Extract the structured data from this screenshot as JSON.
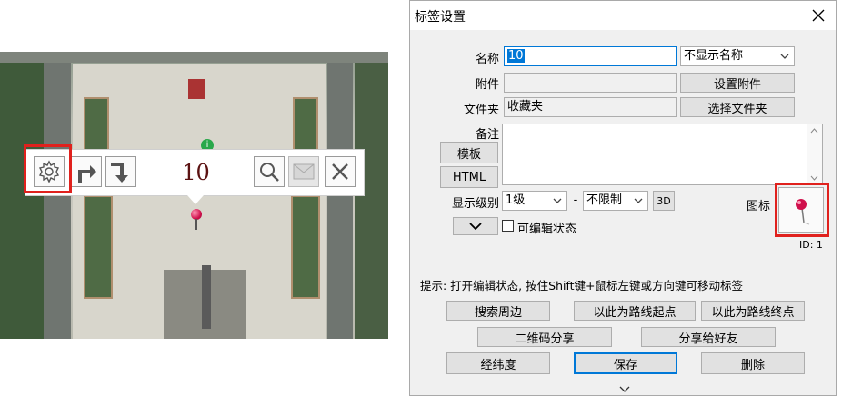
{
  "map_popup": {
    "number": "10"
  },
  "dialog": {
    "title": "标签设置",
    "labels": {
      "name": "名称",
      "attachment": "附件",
      "folder": "文件夹",
      "remark": "备注",
      "display_level": "显示级别",
      "dash": "-",
      "icon": "图标"
    },
    "name_value": "10",
    "attachment_value": "",
    "folder_value": "收藏夹",
    "remark_value": "",
    "name_display_select": "不显示名称",
    "level_min_select": "1级",
    "level_max_select": "不限制",
    "buttons": {
      "set_attachment": "设置附件",
      "choose_folder": "选择文件夹",
      "template": "模板",
      "html": "HTML",
      "three_d": "3D",
      "search_nearby": "搜索周边",
      "route_start": "以此为路线起点",
      "route_end": "以此为路线终点",
      "qr_share": "二维码分享",
      "share_friend": "分享给好友",
      "coordinates": "经纬度",
      "save": "保存",
      "delete": "删除"
    },
    "editable_label": "可编辑状态",
    "editable_checked": false,
    "id_label": "ID: 1",
    "hint": "提示: 打开编辑状态, 按住Shift键+鼠标左键或方向键可移动标签"
  },
  "colors": {
    "highlight_box": "#e0211d",
    "focus_blue": "#0078d7",
    "pin": "#d0104c"
  }
}
